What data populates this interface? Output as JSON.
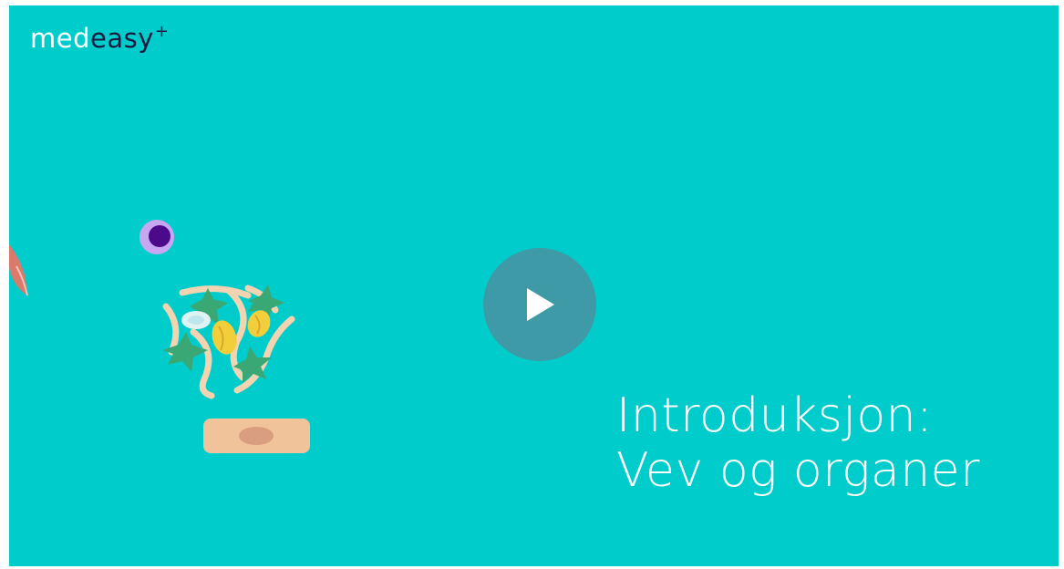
{
  "video": {
    "logo": {
      "part1": "med",
      "part2": "easy",
      "plus": "+"
    },
    "title_line1": "Introduksjon:",
    "title_line2": "Vev og organer",
    "play_icon": "play-icon",
    "colors": {
      "background": "#00cccc",
      "play_button": "#3d9aa6",
      "logo_dark": "#1a1a40"
    }
  }
}
